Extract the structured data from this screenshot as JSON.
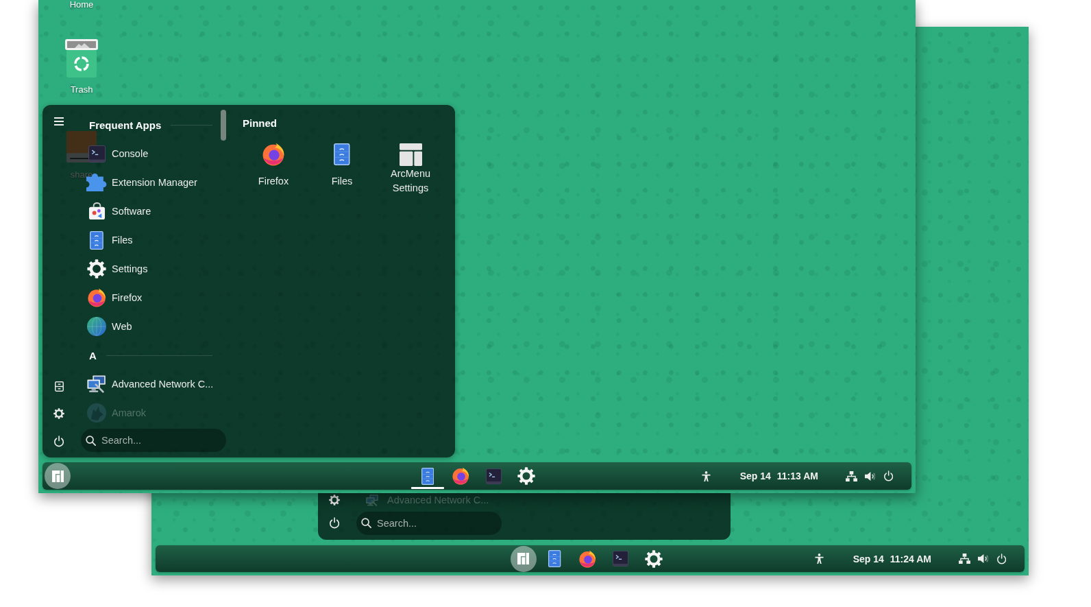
{
  "front_screen": {
    "desktop_icons": [
      {
        "kind": "home",
        "label": "Home"
      },
      {
        "kind": "trash",
        "label": "Trash"
      },
      {
        "kind": "drive",
        "label": "share"
      }
    ],
    "menu": {
      "sections": [
        {
          "title": "Frequent Apps",
          "items": [
            {
              "kind": "terminal",
              "label": "Console",
              "dimmed": false
            },
            {
              "kind": "puzzle",
              "label": "Extension Manager",
              "dimmed": false
            },
            {
              "kind": "software",
              "label": "Software",
              "dimmed": false
            },
            {
              "kind": "files",
              "label": "Files",
              "dimmed": false
            },
            {
              "kind": "settings",
              "label": "Settings",
              "dimmed": false
            },
            {
              "kind": "firefox",
              "label": "Firefox",
              "dimmed": false
            },
            {
              "kind": "globe",
              "label": "Web",
              "dimmed": false
            }
          ]
        },
        {
          "title": "A",
          "items": [
            {
              "kind": "network",
              "label": "Advanced Network C...",
              "dimmed": false
            },
            {
              "kind": "wolf",
              "label": "Amarok",
              "dimmed": true
            }
          ]
        }
      ],
      "search": {
        "placeholder": "Search..."
      },
      "pinned": {
        "title": "Pinned",
        "items": [
          {
            "kind": "firefox",
            "label": "Firefox"
          },
          {
            "kind": "files",
            "label": "Files"
          },
          {
            "kind": "arcmenu",
            "label": "ArcMenu Settings"
          }
        ]
      }
    },
    "taskbar": {
      "left": [
        {
          "kind": "start",
          "running": false
        }
      ],
      "center": [
        {
          "kind": "files",
          "running": true
        },
        {
          "kind": "firefox",
          "running": false
        },
        {
          "kind": "terminal",
          "running": false
        },
        {
          "kind": "settings",
          "running": false
        }
      ],
      "date": "Sep 14",
      "time": "11:13 AM"
    }
  },
  "back_screen": {
    "menu": {
      "items": [
        {
          "kind": "network",
          "label": "Advanced Network C...",
          "dimmed": true
        }
      ],
      "search": {
        "placeholder": "Search..."
      }
    },
    "taskbar": {
      "center": [
        {
          "kind": "start",
          "running": false
        },
        {
          "kind": "files",
          "running": false
        },
        {
          "kind": "firefox",
          "running": false
        },
        {
          "kind": "terminal",
          "running": false
        },
        {
          "kind": "settings",
          "running": false
        }
      ],
      "date": "Sep 14",
      "time": "11:24 AM"
    }
  }
}
